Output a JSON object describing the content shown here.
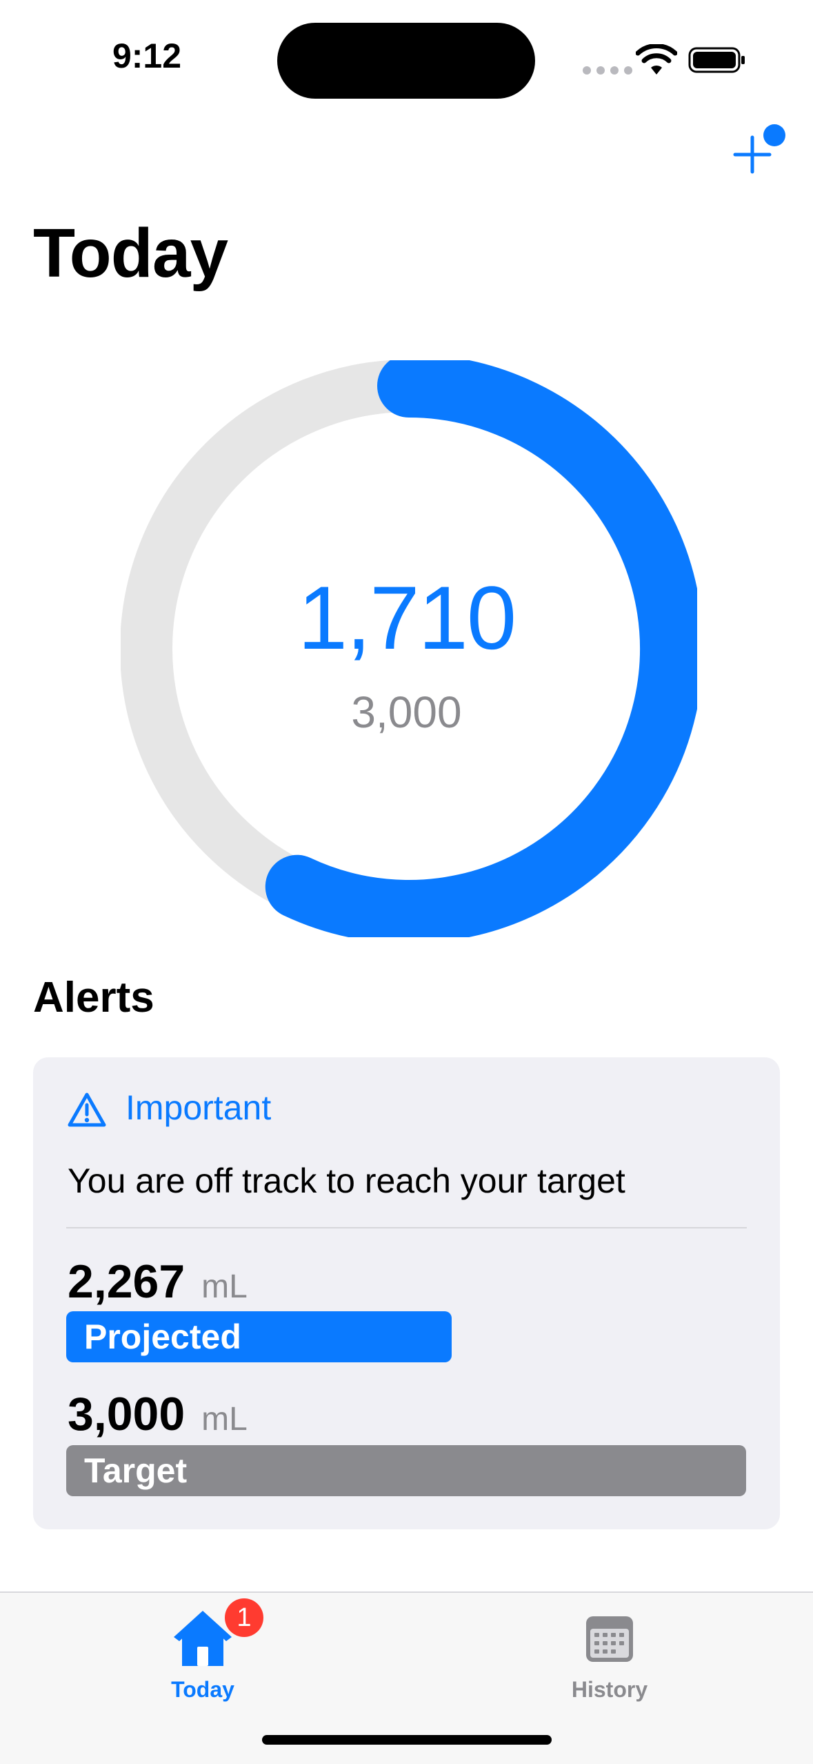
{
  "status_bar": {
    "time": "9:12"
  },
  "header": {
    "title": "Today",
    "add_icon": "plus-icon",
    "accent_color": "#0a7aff"
  },
  "progress": {
    "current": "1,710",
    "target": "3,000",
    "fraction": 0.57
  },
  "alerts": {
    "heading": "Alerts",
    "card": {
      "icon": "warning-triangle-icon",
      "title": "Important",
      "message": "You are off track to reach your target",
      "projected": {
        "value": "2,267",
        "unit": "mL",
        "label": "Projected",
        "fraction": 0.5667,
        "color": "#0a7aff"
      },
      "target": {
        "value": "3,000",
        "unit": "mL",
        "label": "Target",
        "fraction": 1.0,
        "color": "#8a8a8e"
      }
    }
  },
  "tab_bar": {
    "tabs": [
      {
        "label": "Today",
        "icon": "house-icon",
        "badge": "1",
        "active": true
      },
      {
        "label": "History",
        "icon": "calendar-icon",
        "active": false
      }
    ],
    "active_color": "#0a7aff",
    "inactive_color": "#8a8a8e"
  }
}
